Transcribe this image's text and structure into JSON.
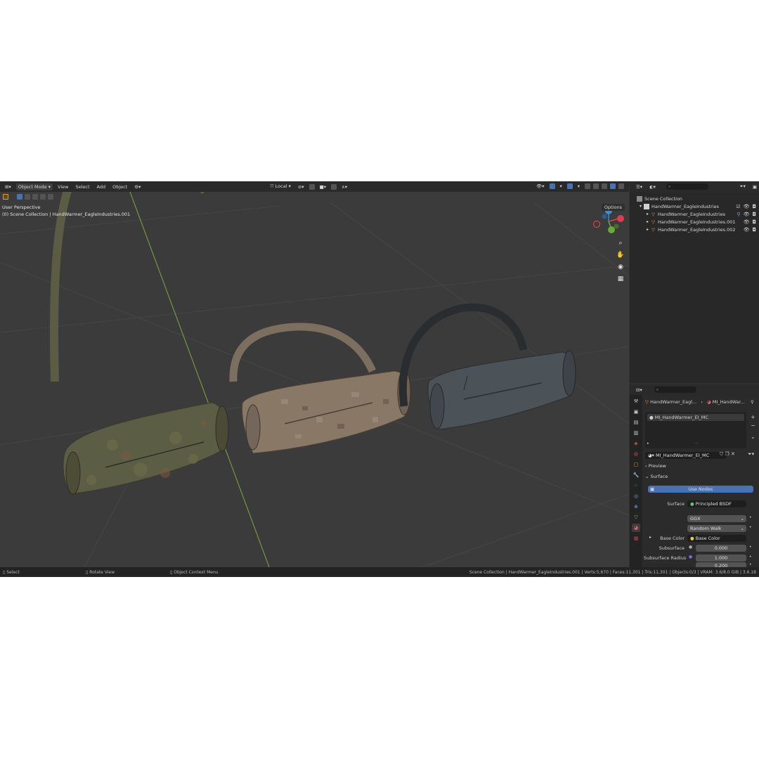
{
  "header": {
    "mode": "Object Mode",
    "menu": [
      "View",
      "Select",
      "Add",
      "Object"
    ],
    "orientation": "Local"
  },
  "viewport": {
    "perspective": "User Perspective",
    "collection": "(0) Scene Collection | HandWarmer_EagleIndustries.001",
    "options": "Options"
  },
  "outliner": {
    "scene_collection": "Scene Collection",
    "collection": "HandWarmer_EagleIndustries",
    "objects": [
      "HandWarmer_EagleIndustries",
      "HandWarmer_EagleIndustries.001",
      "HandWarmer_EagleIndustries.002"
    ]
  },
  "properties": {
    "breadcrumb_object": "HandWarmer_Eagl...",
    "breadcrumb_material": "MI_HandWar...",
    "material_slot": "MI_HandWarmer_EI_MC",
    "material_name": "MI_HandWarmer_EI_MC",
    "preview_label": "Preview",
    "surface_section": "Surface",
    "use_nodes": "Use Nodes",
    "surface_label": "Surface",
    "surface_value": "Principled BSDF",
    "distribution": "GGX",
    "subsurface_method": "Random Walk",
    "base_color_label": "Base Color",
    "base_color_value": "Base Color",
    "subsurface_label": "Subsurface",
    "subsurface_value": "0.000",
    "subsurface_radius_label": "Subsurface Radius",
    "subsurface_radius_1": "1.000",
    "subsurface_radius_2": "0.200"
  },
  "statusbar": {
    "select": "Select",
    "rotate": "Rotate View",
    "context": "Object Context Menu",
    "stats": "Scene Collection | HandWarmer_EagleIndustries.001 | Verts:5,670 | Faces:11,301 | Tris:11,301 | Objects:0/3 | VRAM: 3.6/8.0 GiB | 3.6.18"
  },
  "colors": {
    "accent": "#4772b3",
    "camo_mc": "#5b5e45",
    "camo_aor1": "#8a7866",
    "grey_bag": "#4b5258"
  }
}
